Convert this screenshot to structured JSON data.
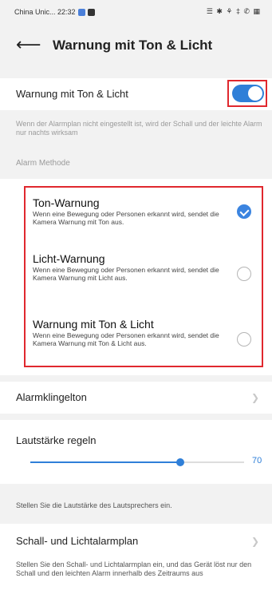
{
  "status_bar": {
    "carrier_time": "China Unic... 22:32",
    "right_icons": "☰ ✱ ⚘ ‡ ✆ ▦"
  },
  "header": {
    "back_icon": "back-arrow-icon",
    "title": "Warnung mit Ton & Licht"
  },
  "toggle_row": {
    "label": "Warnung mit Ton & Licht",
    "enabled": true,
    "accent_color": "#2f7fd8"
  },
  "info_text": "Wenn der Alarmplan nicht eingestellt ist, wird der Schall und der leichte Alarm nur nachts wirksam",
  "alarm_method": {
    "section_label": "Alarm Methode",
    "options": [
      {
        "title": "Ton-Warnung",
        "description": "Wenn eine Bewegung oder Personen erkannt wird, sendet die Kamera Warnung mit Ton aus.",
        "selected": true
      },
      {
        "title": "Licht-Warnung",
        "description": "Wenn eine Bewegung oder Personen erkannt wird, sendet die Kamera Warnung mit Licht aus.",
        "selected": false
      },
      {
        "title": "Warnung mit Ton & Licht",
        "description": "Wenn eine Bewegung oder Personen erkannt wird, sendet die Kamera Warnung mit Ton & Licht aus.",
        "selected": false
      }
    ]
  },
  "ringtone": {
    "label": "Alarmklingelton"
  },
  "volume": {
    "label": "Lautstärke regeln",
    "value": 70,
    "max": 100,
    "hint": "Stellen Sie die Lautstärke des Lautsprechers ein."
  },
  "schedule": {
    "label": "Schall- und Lichtalarmplan",
    "hint": "Stellen Sie den Schall- und Lichtalarmplan ein, und das Gerät löst nur den Schall und den leichten Alarm innerhalb des Zeitraums aus"
  },
  "highlight_color": "#e0282e"
}
